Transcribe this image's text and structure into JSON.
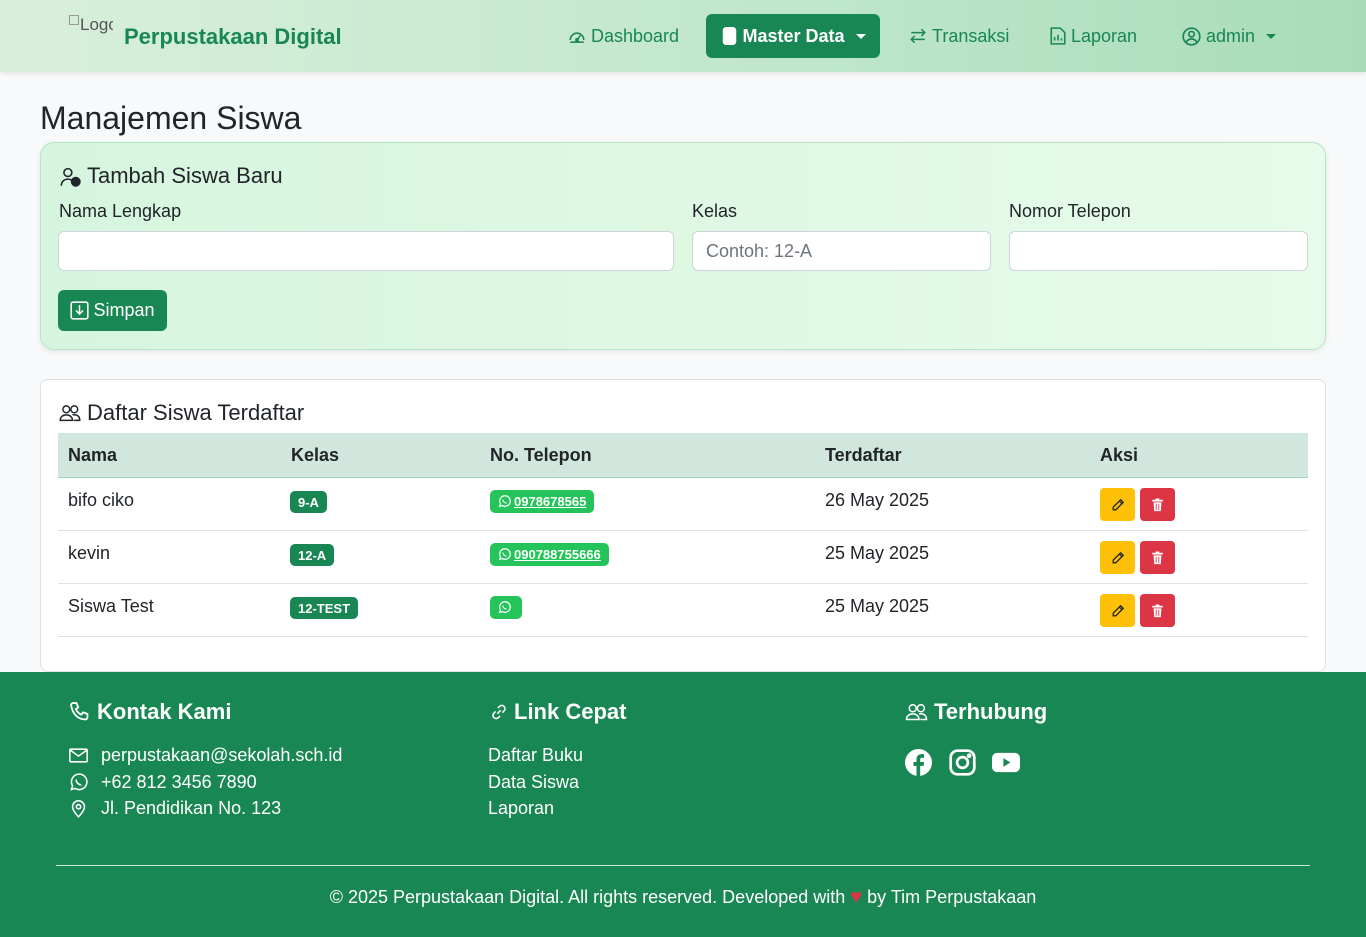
{
  "navbar": {
    "logo_alt": "Logo",
    "brand": "Perpustakaan Digital",
    "items": [
      {
        "label": "Dashboard",
        "icon": "speedometer-icon"
      },
      {
        "label": "Master Data",
        "icon": "database-icon",
        "active": true
      },
      {
        "label": "Transaksi",
        "icon": "arrow-left-right-icon"
      },
      {
        "label": "Laporan",
        "icon": "file-bar-chart-icon"
      }
    ],
    "user": "admin"
  },
  "page": {
    "title": "Manajemen Siswa"
  },
  "form": {
    "title": "Tambah Siswa Baru",
    "fields": {
      "nama": {
        "label": "Nama Lengkap",
        "value": "",
        "placeholder": ""
      },
      "kelas": {
        "label": "Kelas",
        "value": "",
        "placeholder": "Contoh: 12-A"
      },
      "telepon": {
        "label": "Nomor Telepon",
        "value": "",
        "placeholder": ""
      }
    },
    "save_label": "Simpan"
  },
  "list": {
    "title": "Daftar Siswa Terdaftar",
    "columns": [
      "Nama",
      "Kelas",
      "No. Telepon",
      "Terdaftar",
      "Aksi"
    ],
    "rows": [
      {
        "nama": "bifo ciko",
        "kelas": "9-A",
        "telepon": "0978678565",
        "terdaftar": "26 May 2025"
      },
      {
        "nama": "kevin",
        "kelas": "12-A",
        "telepon": "090788755666",
        "terdaftar": "25 May 2025"
      },
      {
        "nama": "Siswa Test",
        "kelas": "12-TEST",
        "telepon": "",
        "terdaftar": "25 May 2025"
      }
    ]
  },
  "footer": {
    "contact": {
      "title": "Kontak Kami",
      "email": "perpustakaan@sekolah.sch.id",
      "phone": "+62 812 3456 7890",
      "address": "Jl. Pendidikan No. 123"
    },
    "links": {
      "title": "Link Cepat",
      "items": [
        "Daftar Buku",
        "Data Siswa",
        "Laporan"
      ]
    },
    "social": {
      "title": "Terhubung",
      "icons": [
        "facebook-icon",
        "instagram-icon",
        "youtube-icon"
      ]
    },
    "copyright_prefix": "© 2025 Perpustakaan Digital. All rights reserved. Developed with",
    "copyright_suffix": "by Tim Perpustakaan"
  },
  "colors": {
    "primary": "#198754",
    "whatsapp": "#25c45a",
    "warning": "#ffc107",
    "danger": "#dc3545"
  }
}
